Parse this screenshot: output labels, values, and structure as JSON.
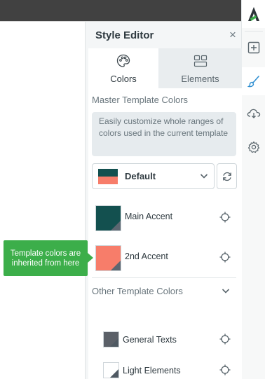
{
  "panel": {
    "title": "Style Editor",
    "close_symbol": "×"
  },
  "tabs": [
    {
      "label": "Colors",
      "icon": "palette-icon",
      "active": true
    },
    {
      "label": "Elements",
      "icon": "layout-icon",
      "active": false
    }
  ],
  "master": {
    "title": "Master Template Colors",
    "hint": "Easily customize whole ranges of colors used in the current template",
    "template_select": {
      "value": "Default",
      "swatch_colors": [
        "#13504f",
        "#f77d6a"
      ]
    },
    "colors": [
      {
        "label": "Main Accent",
        "color": "#13504f"
      },
      {
        "label": "2nd Accent",
        "color": "#f77d6a"
      }
    ]
  },
  "other": {
    "title": "Other Template Colors",
    "colors": [
      {
        "label": "General Texts",
        "color": "#5b6068"
      },
      {
        "label": "Light Elements",
        "color": "#ffffff"
      }
    ]
  },
  "tooltip": {
    "text": "Template colors are inherited from here"
  },
  "rail": {
    "items": [
      "logo-icon",
      "add-icon",
      "brush-icon",
      "cloud-download-icon",
      "gear-icon"
    ],
    "accent": "#2f8fd1"
  }
}
